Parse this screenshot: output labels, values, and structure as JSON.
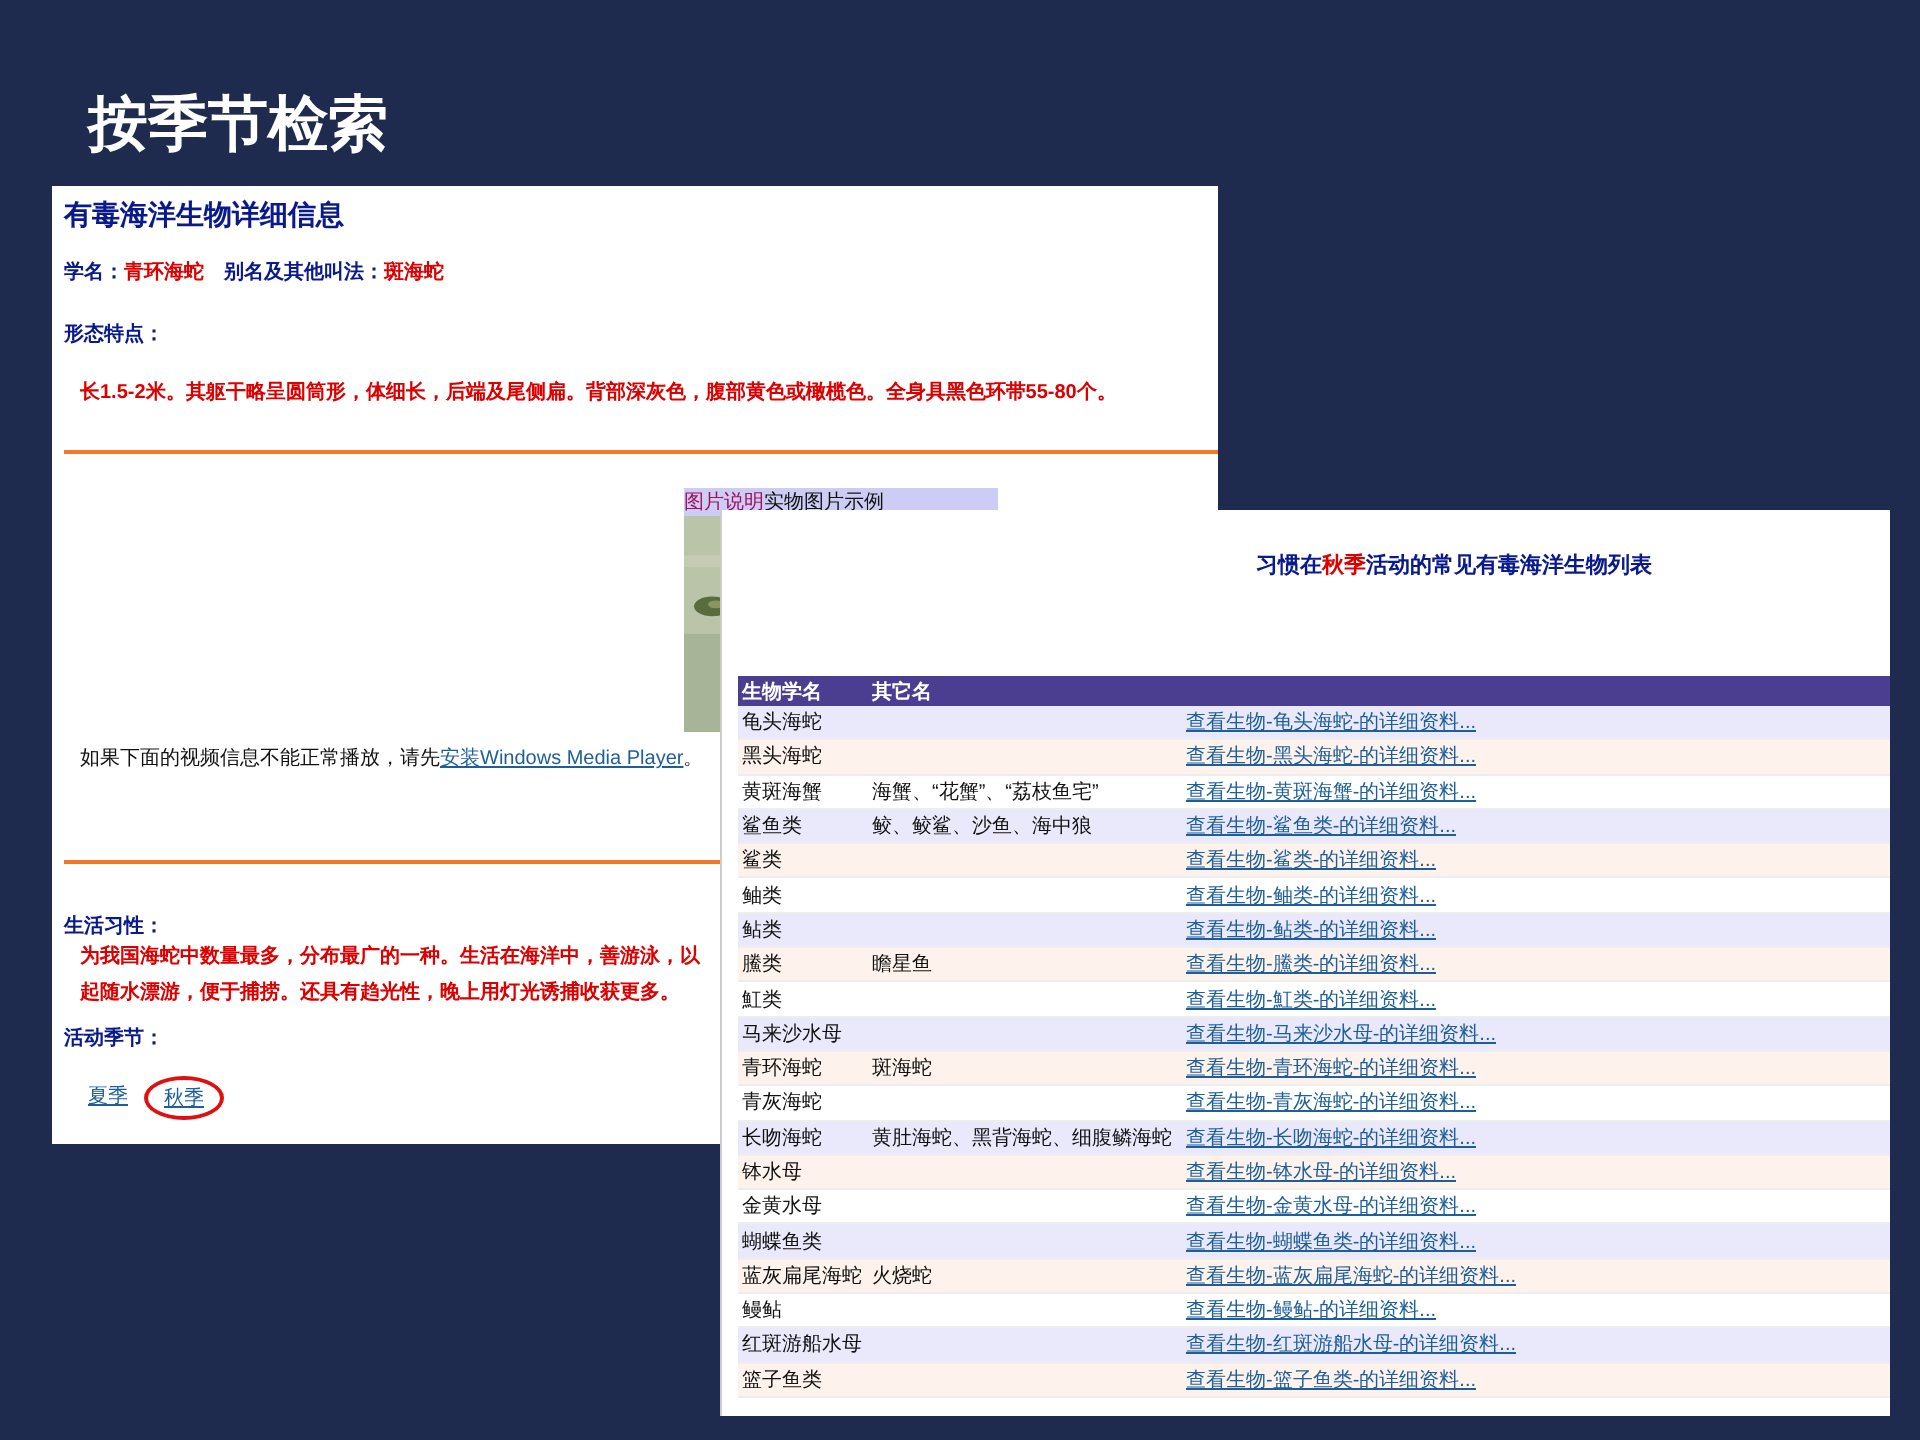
{
  "slide": {
    "title": "按季节检索"
  },
  "detail_page": {
    "title": "有毒海洋生物详细信息",
    "scientific_name_label": "学名：",
    "scientific_name": "青环海蛇",
    "alias_label": "别名及其他叫法：",
    "alias": "斑海蛇",
    "morphology_heading": "形态特点：",
    "morphology_text": "长1.5-2米。其躯干略呈圆筒形，体细长，后端及尾侧扁。背部深灰色，腹部黄色或橄榄色。全身具黑色环带55-80个。",
    "image_caption_label": "图片说明",
    "image_caption": "实物图片示例",
    "video_notice": "如果下面的视频信息不能正常播放，请先",
    "video_link": "安装Windows Media Player",
    "video_notice_end": "。",
    "habits_heading": "生活习性：",
    "habits_lines": [
      "为我国海蛇中数量最多，分布最广的一种。生活在海洋中，善游泳，以",
      "起随水漂游，便于捕捞。还具有趋光性，晚上用灯光诱捕收获更多。"
    ],
    "season_heading": "活动季节：",
    "seasons": [
      {
        "label": "夏季",
        "circled": false
      },
      {
        "label": "秋季",
        "circled": true
      }
    ]
  },
  "list_page": {
    "title_before": "习惯在",
    "title_highlight": "秋季",
    "title_after": "活动的常见有毒海洋生物列表",
    "columns": [
      "生物学名",
      "其它名"
    ],
    "rows": [
      {
        "name": "龟头海蛇",
        "link": "查看生物-龟头海蛇-的详细资料..."
      },
      {
        "name": "黑头海蛇",
        "link": "查看生物-黑头海蛇-的详细资料..."
      },
      {
        "name": "黄斑海蟹",
        "other_name": "海蟹、“花蟹”、“荔枝鱼宅”",
        "link": "查看生物-黄斑海蟹-的详细资料..."
      },
      {
        "name": "鲨鱼类",
        "other_name": "鲛、鲛鲨、沙鱼、海中狼",
        "link": "查看生物-鲨鱼类-的详细资料..."
      },
      {
        "name": "鲨类",
        "link": "查看生物-鲨类-的详细资料..."
      },
      {
        "name": "鲉类",
        "link": "查看生物-鲉类-的详细资料..."
      },
      {
        "name": "鲇类",
        "link": "查看生物-鲇类-的详细资料..."
      },
      {
        "name": "鰧类",
        "other_name": "瞻星鱼",
        "link": "查看生物-鰧类-的详细资料..."
      },
      {
        "name": "魟类",
        "link": "查看生物-魟类-的详细资料..."
      },
      {
        "name": "马来沙水母",
        "link": "查看生物-马来沙水母-的详细资料..."
      },
      {
        "name": "青环海蛇",
        "other_name": "斑海蛇",
        "link": "查看生物-青环海蛇-的详细资料..."
      },
      {
        "name": "青灰海蛇",
        "link": "查看生物-青灰海蛇-的详细资料..."
      },
      {
        "name": "长吻海蛇",
        "other_name": "黄肚海蛇、黑背海蛇、细腹鳞海蛇",
        "link": "查看生物-长吻海蛇-的详细资料..."
      },
      {
        "name": "钵水母",
        "link": "查看生物-钵水母-的详细资料..."
      },
      {
        "name": "金黄水母",
        "link": "查看生物-金黄水母-的详细资料..."
      },
      {
        "name": "蝴蝶鱼类",
        "link": "查看生物-蝴蝶鱼类-的详细资料..."
      },
      {
        "name": "蓝灰扁尾海蛇",
        "other_name": "火烧蛇",
        "link": "查看生物-蓝灰扁尾海蛇-的详细资料..."
      },
      {
        "name": "鳗鲇",
        "link": "查看生物-鳗鲇-的详细资料..."
      },
      {
        "name": "红斑游船水母",
        "link": "查看生物-红斑游船水母-的详细资料..."
      },
      {
        "name": "篮子鱼类",
        "link": "查看生物-篮子鱼类-的详细资料..."
      }
    ]
  }
}
